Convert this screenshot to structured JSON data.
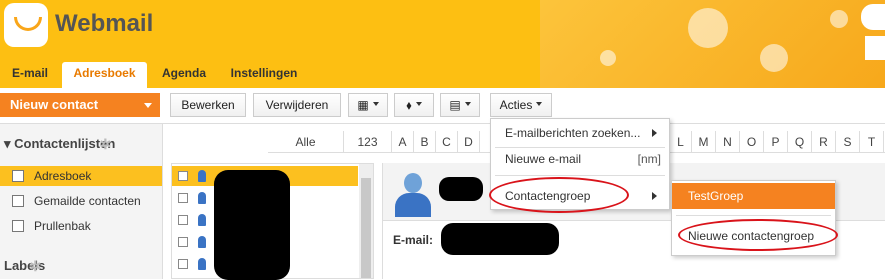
{
  "app": {
    "brand": "Webmail"
  },
  "tabs": [
    {
      "label": "E-mail"
    },
    {
      "label": "Adresboek",
      "active": true
    },
    {
      "label": "Agenda"
    },
    {
      "label": "Instellingen"
    }
  ],
  "toolbar": {
    "new_contact": "Nieuw contact",
    "edit": "Bewerken",
    "delete": "Verwijderen",
    "actions": "Acties"
  },
  "sidebar": {
    "contact_lists_heading": "Contactenlijsten",
    "items": [
      {
        "label": "Adresboek",
        "selected": true
      },
      {
        "label": "Gemailde contacten"
      },
      {
        "label": "Prullenbak"
      }
    ],
    "labels_heading": "Labels"
  },
  "alphabet": [
    "Alle",
    "123",
    "A",
    "B",
    "C",
    "D",
    "L",
    "M",
    "N",
    "O",
    "P",
    "Q",
    "R",
    "S",
    "T"
  ],
  "detail": {
    "email_label": "E-mail:"
  },
  "actions_menu": {
    "items": [
      {
        "label": "E-mailberichten zoeken...",
        "submenu": true
      },
      {
        "label": "Nieuwe e-mail",
        "hint": "[nm]"
      },
      {
        "label": "Contactengroep",
        "submenu": true
      }
    ]
  },
  "group_submenu": {
    "selected": "TestGroep",
    "new_group": "Nieuwe contactengroep"
  },
  "colors": {
    "accent": "#f58220",
    "header": "#fdbf12",
    "highlight": "#d9131a"
  }
}
